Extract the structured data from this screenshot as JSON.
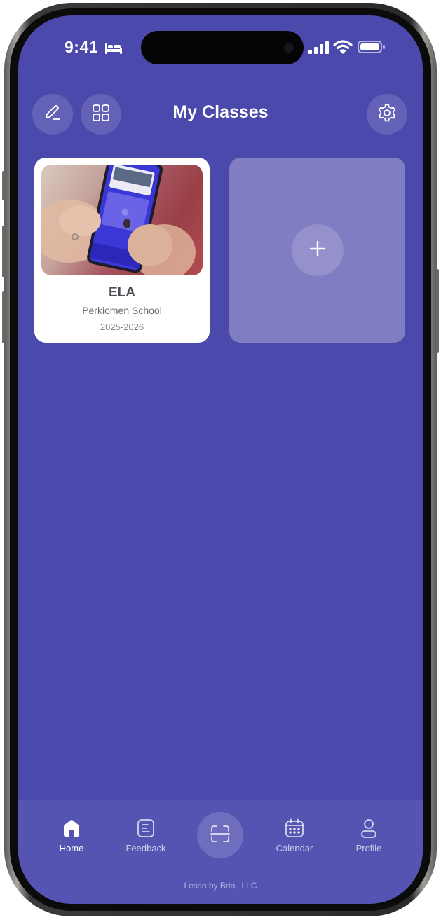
{
  "status_bar": {
    "time": "9:41",
    "icons": [
      "bed-icon",
      "signal-icon",
      "wifi-icon",
      "battery-icon"
    ]
  },
  "header": {
    "title": "My Classes",
    "left_buttons": [
      "pencil-icon",
      "grid-icon"
    ],
    "right_button": "gear-icon"
  },
  "classes": [
    {
      "title": "ELA",
      "school": "Perkiomen School",
      "year": "2025-2026"
    }
  ],
  "add_class": {
    "icon": "plus-icon"
  },
  "tabbar": {
    "tabs": [
      {
        "label": "Home",
        "icon": "home-icon",
        "active": true
      },
      {
        "label": "Feedback",
        "icon": "feedback-icon",
        "active": false
      },
      {
        "label": "",
        "icon": "scan-icon",
        "active": false
      },
      {
        "label": "Calendar",
        "icon": "calendar-icon",
        "active": false
      },
      {
        "label": "Profile",
        "icon": "profile-icon",
        "active": false
      }
    ]
  },
  "footer": "Lessn by Brinl, LLC",
  "colors": {
    "background": "#4b49ac",
    "tabbar": "#5654b3",
    "add_card": "#807dc3",
    "card": "#ffffff"
  }
}
